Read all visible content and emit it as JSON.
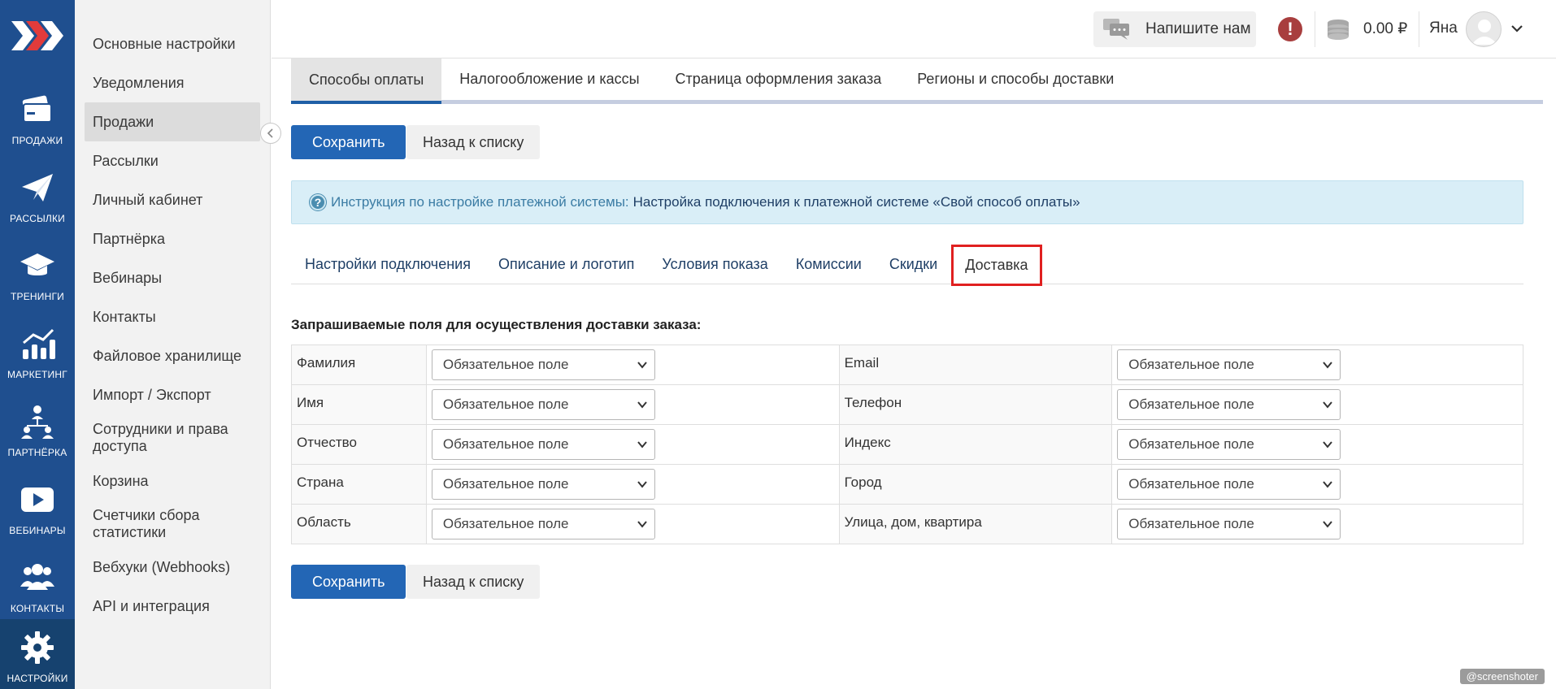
{
  "rail": {
    "items": [
      {
        "label": "ПРОДАЖИ",
        "icon": "wallet-icon"
      },
      {
        "label": "РАССЫЛКИ",
        "icon": "paper-plane-icon"
      },
      {
        "label": "ТРЕНИНГИ",
        "icon": "graduation-cap-icon"
      },
      {
        "label": "МАРКЕТИНГ",
        "icon": "chart-growth-icon"
      },
      {
        "label": "ПАРТНЁРКА",
        "icon": "partner-network-icon"
      },
      {
        "label": "ВЕБИНАРЫ",
        "icon": "play-icon"
      },
      {
        "label": "КОНТАКТЫ",
        "icon": "contacts-icon"
      },
      {
        "label": "НАСТРОЙКИ",
        "icon": "gear-icon"
      }
    ],
    "active_color": "#16426f",
    "bg_color": "#1f4f8f"
  },
  "settings_nav": {
    "items": [
      "Основные настройки",
      "Уведомления",
      "Продажи",
      "Рассылки",
      "Личный кабинет",
      "Партнёрка",
      "Вебинары",
      "Контакты",
      "Файловое хранилище",
      "Импорт / Экспорт",
      "Сотрудники и права доступа",
      "Корзина",
      "Счетчики сбора статистики",
      "Вебхуки (Webhooks)",
      "API и интеграция"
    ],
    "active_index": 2
  },
  "header": {
    "write_us": "Напишите нам",
    "alert_symbol": "!",
    "balance": "0.00 ₽",
    "user_name": "Яна"
  },
  "main_tabs": {
    "items": [
      "Способы оплаты",
      "Налогообложение и кассы",
      "Страница оформления заказа",
      "Регионы и способы доставки"
    ],
    "active_index": 0
  },
  "actions": {
    "save": "Сохранить",
    "back": "Назад к списку"
  },
  "info": {
    "label": "Инструкция по настройке платежной системы:",
    "link": "Настройка подключения к платежной системе «Свой способ оплаты»"
  },
  "sub_tabs": {
    "items": [
      "Настройки подключения",
      "Описание и логотип",
      "Условия показа",
      "Комиссии",
      "Скидки",
      "Доставка"
    ],
    "active_index": 5
  },
  "section": {
    "title": "Запрашиваемые поля для осуществления доставки заказа:"
  },
  "fields": {
    "rows": [
      {
        "left_label": "Фамилия",
        "left_value": "Обязательное поле",
        "right_label": "Email",
        "right_value": "Обязательное поле"
      },
      {
        "left_label": "Имя",
        "left_value": "Обязательное поле",
        "right_label": "Телефон",
        "right_value": "Обязательное поле"
      },
      {
        "left_label": "Отчество",
        "left_value": "Обязательное поле",
        "right_label": "Индекс",
        "right_value": "Обязательное поле"
      },
      {
        "left_label": "Страна",
        "left_value": "Обязательное поле",
        "right_label": "Город",
        "right_value": "Обязательное поле"
      },
      {
        "left_label": "Область",
        "left_value": "Обязательное поле",
        "right_label": "Улица, дом, квартира",
        "right_value": "Обязательное поле"
      }
    ]
  },
  "watermark": "@screenshoter"
}
